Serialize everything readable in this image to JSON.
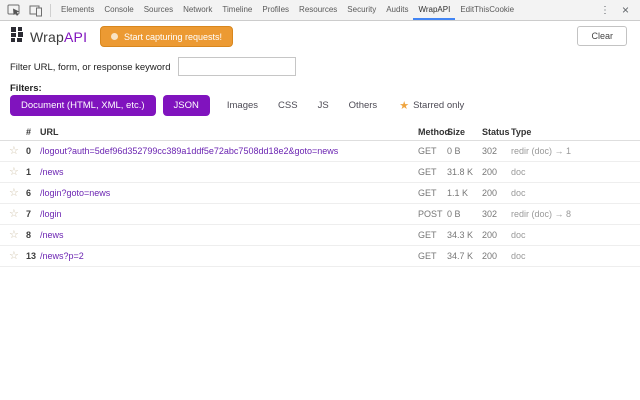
{
  "devtools": {
    "tabs": [
      "Elements",
      "Console",
      "Sources",
      "Network",
      "Timeline",
      "Profiles",
      "Resources",
      "Security",
      "Audits",
      "WrapAPI",
      "EditThisCookie"
    ],
    "selected_tab": "WrapAPI"
  },
  "icons": {
    "menu": "⋮",
    "close": "×",
    "star_outline": "☆",
    "star_filled": "★"
  },
  "header": {
    "brand_wrap": "Wrap",
    "brand_api": "API",
    "capture_button": "Start capturing requests!",
    "clear_button": "Clear"
  },
  "filter": {
    "label": "Filter URL, form, or response keyword",
    "value": ""
  },
  "filters": {
    "label": "Filters:",
    "buttons": [
      {
        "label": "Document (HTML, XML, etc.)",
        "active": true
      },
      {
        "label": "JSON",
        "active": true
      },
      {
        "label": "Images",
        "active": false
      },
      {
        "label": "CSS",
        "active": false
      },
      {
        "label": "JS",
        "active": false
      },
      {
        "label": "Others",
        "active": false
      }
    ],
    "starred_only_label": "Starred only"
  },
  "table": {
    "headers": {
      "num": "#",
      "url": "URL",
      "method": "Method",
      "size": "Size",
      "status": "Status",
      "type": "Type"
    },
    "rows": [
      {
        "num": "0",
        "url": "/logout?auth=5def96d352799cc389a1ddf5e72abc7508dd18e2&goto=news",
        "method": "GET",
        "size": "0 B",
        "status": "302",
        "type": "redir (doc) → 1"
      },
      {
        "num": "1",
        "url": "/news",
        "method": "GET",
        "size": "31.8 K",
        "status": "200",
        "type": "doc"
      },
      {
        "num": "6",
        "url": "/login?goto=news",
        "method": "GET",
        "size": "1.1 K",
        "status": "200",
        "type": "doc"
      },
      {
        "num": "7",
        "url": "/login",
        "method": "POST",
        "size": "0 B",
        "status": "302",
        "type": "redir (doc) → 8"
      },
      {
        "num": "8",
        "url": "/news",
        "method": "GET",
        "size": "34.3 K",
        "status": "200",
        "type": "doc"
      },
      {
        "num": "13",
        "url": "/news?p=2",
        "method": "GET",
        "size": "34.7 K",
        "status": "200",
        "type": "doc"
      }
    ]
  },
  "colors": {
    "accent_purple": "#8013BE",
    "accent_orange": "#EC9A33",
    "tab_highlight_blue": "#4285F4",
    "star_gold": "#EFA43F",
    "url_link": "#6B24B2"
  }
}
